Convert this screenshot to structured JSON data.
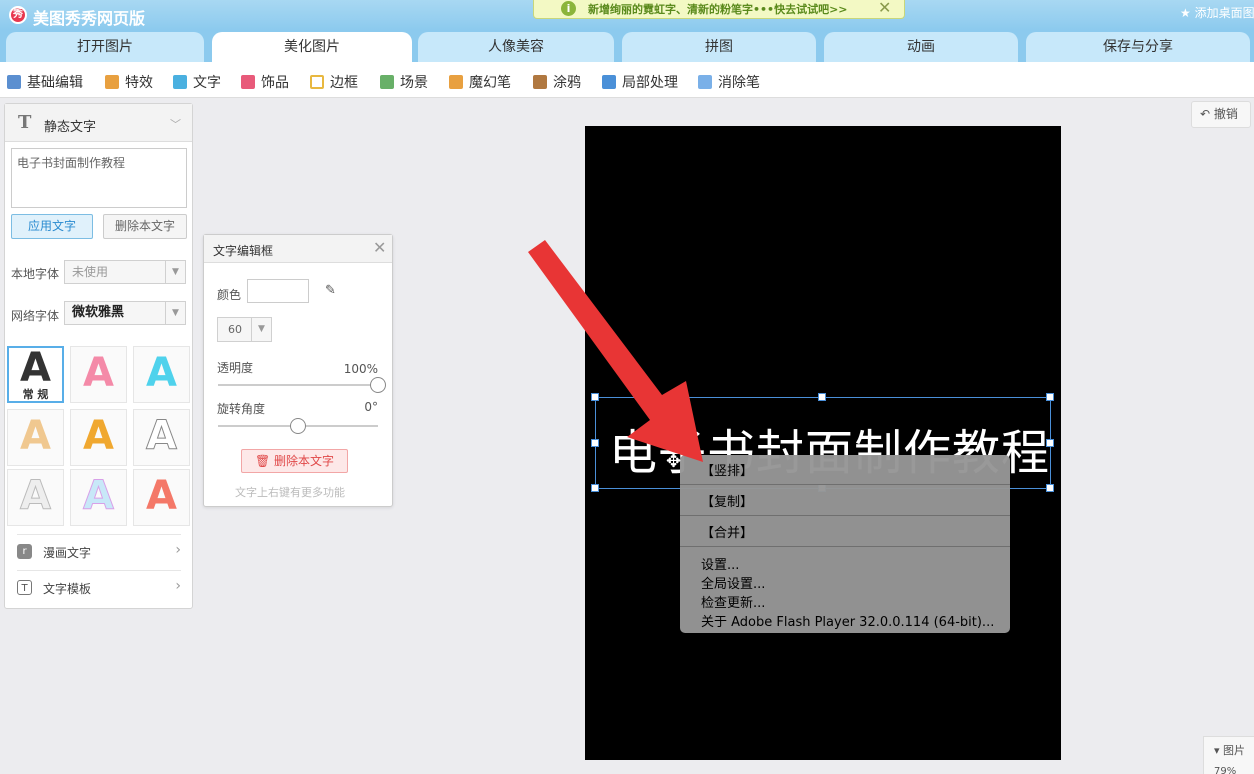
{
  "app": {
    "title": "美图秀秀网页版",
    "logo_text": "秀"
  },
  "notice": {
    "text": "新增绚丽的霓虹字、清新的粉笔字•••快去试试吧>>",
    "close": "✕"
  },
  "header": {
    "add_desktop": "添加桌面图"
  },
  "tabs": [
    {
      "label": "打开图片"
    },
    {
      "label": "美化图片"
    },
    {
      "label": "人像美容"
    },
    {
      "label": "拼图"
    },
    {
      "label": "动画"
    },
    {
      "label": "保存与分享"
    }
  ],
  "subtools": [
    {
      "label": "基础编辑",
      "color": "#5b8fd0"
    },
    {
      "label": "特效",
      "color": "#e8a040"
    },
    {
      "label": "文字",
      "color": "#4ab0e0"
    },
    {
      "label": "饰品",
      "color": "#e85a7a"
    },
    {
      "label": "边框",
      "color": "#e8b840"
    },
    {
      "label": "场景",
      "color": "#68b068"
    },
    {
      "label": "魔幻笔",
      "color": "#e8a040"
    },
    {
      "label": "涂鸦",
      "color": "#b07840"
    },
    {
      "label": "局部处理",
      "color": "#4a90d8"
    },
    {
      "label": "消除笔",
      "color": "#7ab0e8"
    }
  ],
  "left_panel": {
    "title": "静态文字",
    "text_value": "电子书封面制作教程",
    "apply_button": "应用文字",
    "delete_button": "删除本文字",
    "local_font_label": "本地字体",
    "local_font_value": "未使用",
    "web_font_label": "网络字体",
    "web_font_value": "微软雅黑",
    "styles": [
      {
        "glyph": "A",
        "caption": "常 规"
      },
      {
        "glyph": "A"
      },
      {
        "glyph": "A"
      },
      {
        "glyph": "A"
      },
      {
        "glyph": "A"
      },
      {
        "glyph": "A"
      },
      {
        "glyph": "A"
      },
      {
        "glyph": "A"
      },
      {
        "glyph": "A"
      }
    ],
    "comic_text": "漫画文字",
    "text_template": "文字模板"
  },
  "editor": {
    "title": "文字编辑框",
    "color_label": "颜色",
    "size_value": "60",
    "opacity_label": "透明度",
    "opacity_value": "100%",
    "opacity": 1.0,
    "rotate_label": "旋转角度",
    "rotate_value": "0°",
    "rotate_fraction": 0.5,
    "delete_button": "删除本文字",
    "hint": "文字上右键有更多功能"
  },
  "toolbar": {
    "undo": "撤销"
  },
  "canvas": {
    "text": "电子书封面制作教程"
  },
  "context_menu": {
    "items": [
      "【竖排】",
      "【复制】",
      "【合并】"
    ],
    "settings": "设置...",
    "global_settings": "全局设置...",
    "check_update": "检查更新...",
    "about": "关于 Adobe Flash Player 32.0.0.114 (64-bit)..."
  },
  "bottom_panel": {
    "label": "图片",
    "zoom": "79%"
  }
}
